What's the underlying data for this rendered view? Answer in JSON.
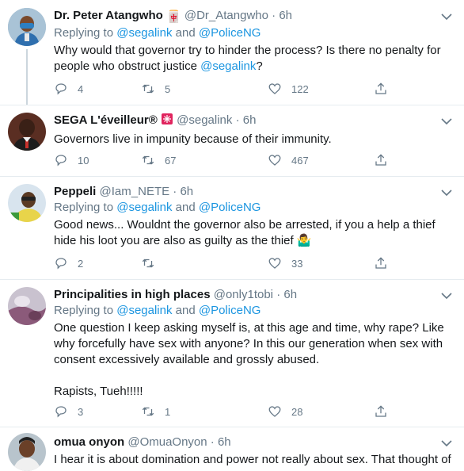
{
  "tweets": [
    {
      "name": "Dr. Peter Atangwho",
      "name_emoji": "🀄",
      "handle": "@Dr_Atangwho",
      "time": "6h",
      "replying_prefix": "Replying to",
      "reply_to_1": "@segalink",
      "reply_to_and": "and",
      "reply_to_2": "@PoliceNG",
      "text_main": "Why would that governor try to hinder the process? Is there no penalty for people who obstruct justice",
      "text_mention": "@segalink",
      "text_end": "?",
      "replies": "4",
      "retweets": "5",
      "likes": "122"
    },
    {
      "name": "SEGA L'éveilleur®",
      "handle": "@segalink",
      "time": "6h",
      "text": "Governors live in impunity because of their immunity.",
      "replies": "10",
      "retweets": "67",
      "likes": "467"
    },
    {
      "name": "Peppeli",
      "handle": "@Iam_NETE",
      "time": "6h",
      "replying_prefix": "Replying to",
      "reply_to_1": "@segalink",
      "reply_to_and": "and",
      "reply_to_2": "@PoliceNG",
      "text": "Good news... Wouldnt  the governor also be arrested, if you a help a thief hide his loot you are also as guilty as the thief 🤷‍♂️",
      "replies": "2",
      "retweets": "",
      "likes": "33"
    },
    {
      "name": "Principalities in high places",
      "handle": "@only1tobi",
      "time": "6h",
      "replying_prefix": "Replying to",
      "reply_to_1": "@segalink",
      "reply_to_and": "and",
      "reply_to_2": "@PoliceNG",
      "text": "One question I keep asking myself is, at this age and time, why rape? Like why forcefully have sex with anyone? In this our generation when sex with consent excessively available and grossly abused.",
      "text_2": "Rapists, Tueh!!!!!",
      "replies": "3",
      "retweets": "1",
      "likes": "28"
    },
    {
      "name": "omua onyon",
      "handle": "@OmuaOnyon",
      "time": "6h",
      "text": "I hear it is about domination and power not really about sex. That thought of"
    }
  ],
  "separator": "·"
}
